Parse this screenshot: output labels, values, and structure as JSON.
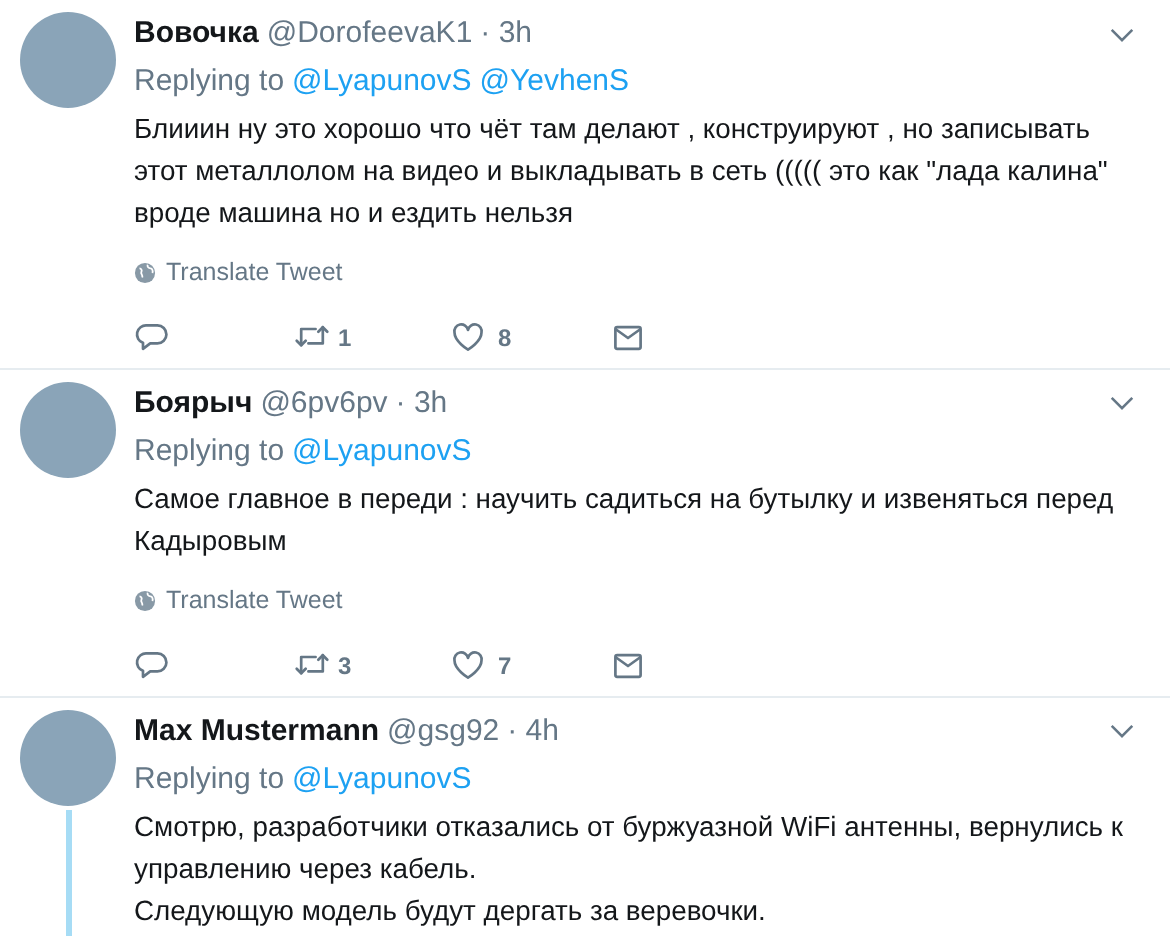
{
  "tweets": [
    {
      "name": "Вовочка",
      "handle": "@DorofeevaK1",
      "time": "· 3h",
      "replying_label": "Replying to",
      "replying_to": [
        "@LyapunovS",
        "@YevhenS"
      ],
      "paragraphs": [
        "Блииин ну это хорошо что чёт там делают , конструируют , но записывать этот металлолом на видео и выкладывать в сеть ((((( это как \"лада калина\" вроде машина но и ездить нельзя"
      ],
      "translate": "Translate Tweet",
      "retweets": "1",
      "likes": "8",
      "thread": false
    },
    {
      "name": "Боярыч",
      "handle": "@6pv6pv",
      "time": "· 3h",
      "replying_label": "Replying to",
      "replying_to": [
        "@LyapunovS"
      ],
      "paragraphs": [
        "Самое главное в переди : научить садиться на бутылку и извеняться перед Кадыровым"
      ],
      "translate": "Translate Tweet",
      "retweets": "3",
      "likes": "7",
      "thread": false
    },
    {
      "name": "Max Mustermann",
      "handle": "@gsg92",
      "time": "· 4h",
      "replying_label": "Replying to",
      "replying_to": [
        "@LyapunovS"
      ],
      "paragraphs": [
        "Смотрю, разработчики отказались от буржуазной WiFi антенны, вернулись к управлению через кабель.",
        "Следующую модель будут дергать за веревочки."
      ],
      "thread": true
    }
  ]
}
